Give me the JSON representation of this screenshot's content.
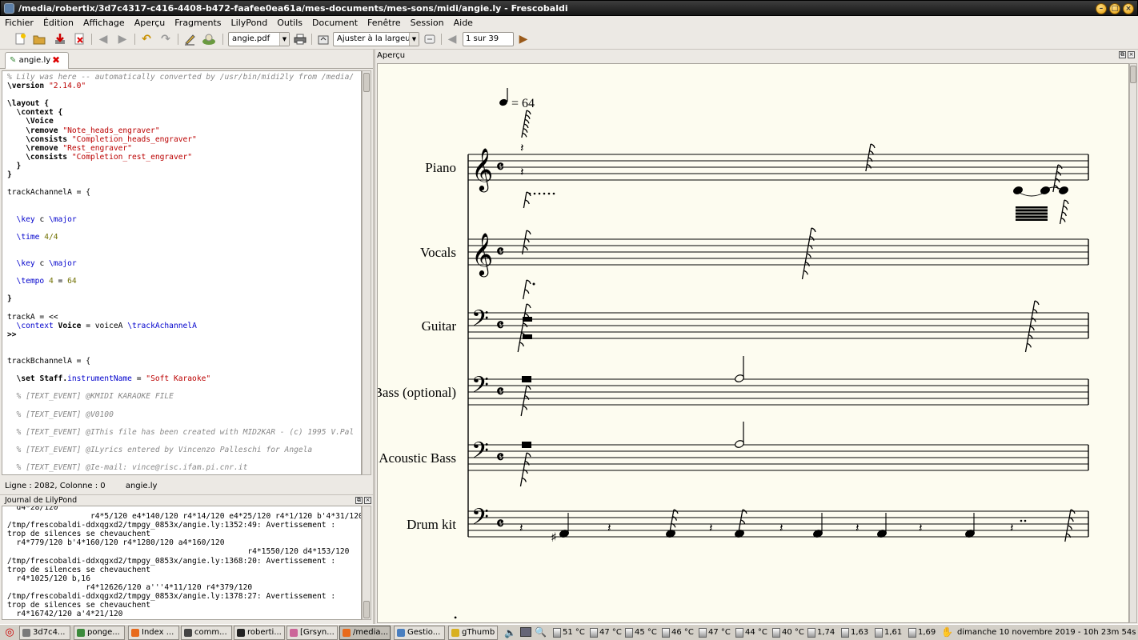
{
  "window": {
    "title": "/media/robertix/3d7c4317-c416-4408-b472-faafee0ea61a/mes-documents/mes-sons/midi/angie.ly - Frescobaldi"
  },
  "menu": [
    "Fichier",
    "Édition",
    "Affichage",
    "Aperçu",
    "Fragments",
    "LilyPond",
    "Outils",
    "Document",
    "Fenêtre",
    "Session",
    "Aide"
  ],
  "toolbar": {
    "document_combo": "angie.pdf",
    "zoom_combo": "Ajuster à la largeur",
    "page_field": "1 sur 39",
    "icons": [
      "new-document-icon",
      "open-folder-icon",
      "save-icon",
      "close-document-icon",
      "back-arrow-icon",
      "forward-arrow-icon",
      "undo-icon",
      "redo-icon",
      "edit-pencil-icon",
      "lilypond-run-icon",
      "print-icon",
      "sync-icon",
      "previous-page-icon",
      "next-page-icon"
    ]
  },
  "editor": {
    "tab_label": "angie.ly",
    "lines": [
      [
        {
          "t": "% Lily was here -- automatically converted by /usr/bin/midi2ly from /media/",
          "c": "com"
        }
      ],
      [
        {
          "t": "\\version ",
          "c": "kw"
        },
        {
          "t": "\"2.14.0\"",
          "c": "str"
        }
      ],
      [],
      [
        {
          "t": "\\layout {",
          "c": "kw"
        }
      ],
      [
        {
          "t": "  \\context {",
          "c": "kw"
        }
      ],
      [
        {
          "t": "    \\Voice",
          "c": "kw"
        }
      ],
      [
        {
          "t": "    \\remove ",
          "c": "kw"
        },
        {
          "t": "\"Note_heads_engraver\"",
          "c": "str"
        }
      ],
      [
        {
          "t": "    \\consists ",
          "c": "kw"
        },
        {
          "t": "\"Completion_heads_engraver\"",
          "c": "str"
        }
      ],
      [
        {
          "t": "    \\remove ",
          "c": "kw"
        },
        {
          "t": "\"Rest_engraver\"",
          "c": "str"
        }
      ],
      [
        {
          "t": "    \\consists ",
          "c": "kw"
        },
        {
          "t": "\"Completion_rest_engraver\"",
          "c": "str"
        }
      ],
      [
        {
          "t": "  }",
          "c": "kw"
        }
      ],
      [
        {
          "t": "}",
          "c": "kw"
        }
      ],
      [],
      [
        {
          "t": "trackAchannelA = {",
          "c": ""
        }
      ],
      [],
      [],
      [
        {
          "t": "  \\key ",
          "c": "blue"
        },
        {
          "t": "c ",
          "c": ""
        },
        {
          "t": "\\major",
          "c": "blue"
        }
      ],
      [],
      [
        {
          "t": "  \\time ",
          "c": "blue"
        },
        {
          "t": "4/4",
          "c": "num"
        }
      ],
      [],
      [],
      [
        {
          "t": "  \\key ",
          "c": "blue"
        },
        {
          "t": "c ",
          "c": ""
        },
        {
          "t": "\\major",
          "c": "blue"
        }
      ],
      [],
      [
        {
          "t": "  \\tempo ",
          "c": "blue"
        },
        {
          "t": "4",
          "c": "num"
        },
        {
          "t": " = ",
          "c": ""
        },
        {
          "t": "64",
          "c": "num"
        }
      ],
      [],
      [
        {
          "t": "}",
          "c": "kw"
        }
      ],
      [],
      [
        {
          "t": "trackA = <<",
          "c": ""
        }
      ],
      [
        {
          "t": "  \\context ",
          "c": "blue"
        },
        {
          "t": "Voice",
          "c": "kw"
        },
        {
          "t": " = voiceA ",
          "c": ""
        },
        {
          "t": "\\trackAchannelA",
          "c": "blue"
        }
      ],
      [
        {
          "t": ">>",
          "c": "kw"
        }
      ],
      [],
      [],
      [
        {
          "t": "trackBchannelA = {",
          "c": ""
        }
      ],
      [],
      [
        {
          "t": "  \\set ",
          "c": "kw"
        },
        {
          "t": "Staff.",
          "c": "kw"
        },
        {
          "t": "instrumentName",
          "c": "blue"
        },
        {
          "t": " = ",
          "c": ""
        },
        {
          "t": "\"Soft Karaoke\"",
          "c": "str"
        }
      ],
      [],
      [
        {
          "t": "  % [TEXT_EVENT] @KMIDI KARAOKE FILE",
          "c": "com"
        }
      ],
      [],
      [
        {
          "t": "  % [TEXT_EVENT] @V0100",
          "c": "com"
        }
      ],
      [],
      [
        {
          "t": "  % [TEXT_EVENT] @IThis file has been created with MID2KAR - (c) 1995 V.Pal",
          "c": "com"
        }
      ],
      [],
      [
        {
          "t": "  % [TEXT_EVENT] @ILyrics entered by Vincenzo Palleschi for Angela",
          "c": "com"
        }
      ],
      [],
      [
        {
          "t": "  % [TEXT_EVENT] @Ie-mail: vince@risc.ifam.pi.cnr.it",
          "c": "com"
        }
      ]
    ]
  },
  "status": {
    "position": "Ligne  : 2082, Colonne  : 0",
    "filename": "angie.ly"
  },
  "log": {
    "title": "Journal de LilyPond",
    "lines": [
      "  d4*28/120",
      "                  r4*5/120 e4*140/120 r4*14/120 e4*25/120 r4*1/120 b'4*31/120",
      "/tmp/frescobaldi-ddxqgxd2/tmpgy_0853x/angie.ly:1352:49: Avertissement :",
      "trop de silences se chevauchent",
      "  r4*779/120 b'4*160/120 r4*1280/120 a4*160/120",
      "                                                    r4*1550/120 d4*153/120",
      "/tmp/frescobaldi-ddxqgxd2/tmpgy_0853x/angie.ly:1368:20: Avertissement :",
      "trop de silences se chevauchent",
      "  r4*1025/120 b,16",
      "                 r4*12626/120 a'''4*11/120 r4*379/120",
      "/tmp/frescobaldi-ddxqgxd2/tmpgy_0853x/angie.ly:1378:27: Avertissement :",
      "trop de silences se chevauchent",
      "  r4*16742/120 a'4*21/120"
    ]
  },
  "preview": {
    "title": "Aperçu",
    "tempo_value": "= 64",
    "instruments": [
      "Piano",
      "Vocals",
      "Guitar",
      "Bass (optional)",
      "Acoustic Bass",
      "Drum kit"
    ]
  },
  "taskbar": {
    "tasks": [
      {
        "label": "3d7c4...",
        "color": "#7a7a7a"
      },
      {
        "label": "ponge...",
        "color": "#3b8a3b"
      },
      {
        "label": "Index ...",
        "color": "#e86a1c"
      },
      {
        "label": "comm...",
        "color": "#444444"
      },
      {
        "label": "roberti...",
        "color": "#222222"
      },
      {
        "label": "[Grsyn...",
        "color": "#cc6699"
      },
      {
        "label": "/media...",
        "color": "#e86a1c"
      },
      {
        "label": "Gestio...",
        "color": "#4a7fbf"
      },
      {
        "label": "gThumb",
        "color": "#d8b020"
      }
    ],
    "temps": [
      "51 °C",
      "47 °C",
      "45 °C",
      "46 °C",
      "47 °C",
      "44 °C",
      "40 °C",
      "1,74",
      "1,63",
      "1,61",
      "1,69"
    ],
    "clock": "dimanche 10 novembre 2019 - 10h 23m 54s"
  }
}
